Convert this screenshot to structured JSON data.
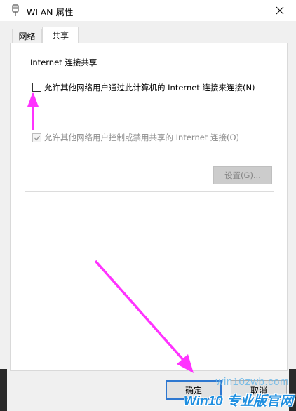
{
  "window": {
    "title": "WLAN 属性",
    "icon": "network-adapter-icon",
    "close_icon": "close-icon"
  },
  "tabs": [
    {
      "label": "网络",
      "selected": false
    },
    {
      "label": "共享",
      "selected": true
    }
  ],
  "sharing": {
    "group_title": "Internet 连接共享",
    "allow_share": {
      "label": "允许其他网络用户通过此计算机的 Internet 连接来连接(N)",
      "checked": false,
      "enabled": true
    },
    "allow_control": {
      "label": "允许其他网络用户控制或禁用共享的 Internet 连接(O)",
      "checked": true,
      "enabled": false
    },
    "settings_button": "设置(G)..."
  },
  "footer": {
    "ok_label": "确定",
    "cancel_label": "取消"
  },
  "annotations": {
    "arrow_color": "#ff33ff"
  },
  "watermark": {
    "url": "win10zwb.com",
    "brand": "Win10 专业版官网"
  }
}
